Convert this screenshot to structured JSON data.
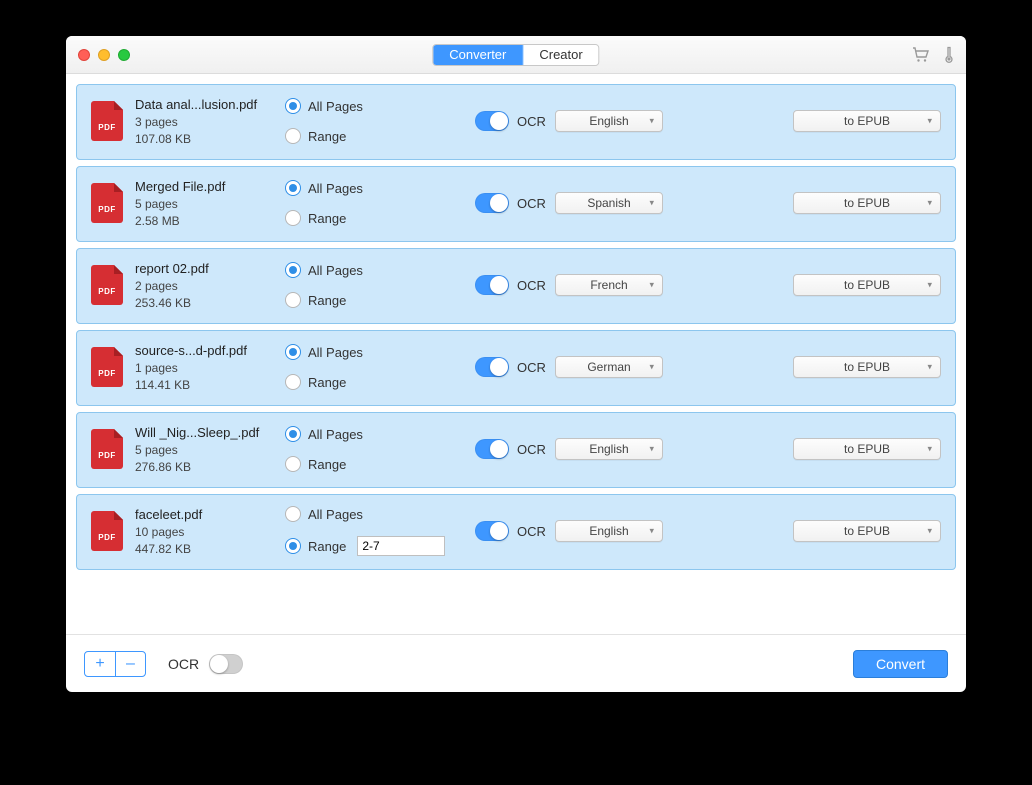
{
  "tabs": {
    "converter": "Converter",
    "creator": "Creator"
  },
  "labels": {
    "all_pages": "All Pages",
    "range": "Range",
    "ocr": "OCR",
    "pdf_badge": "PDF"
  },
  "footer": {
    "ocr_label": "OCR",
    "convert": "Convert",
    "plus": "+",
    "minus": "–"
  },
  "files": [
    {
      "name": "Data anal...lusion.pdf",
      "pages": "3 pages",
      "size": "107.08 KB",
      "page_mode": "all",
      "range_value": "",
      "ocr_on": true,
      "lang": "English",
      "format": "to EPUB"
    },
    {
      "name": "Merged File.pdf",
      "pages": "5 pages",
      "size": "2.58 MB",
      "page_mode": "all",
      "range_value": "",
      "ocr_on": true,
      "lang": "Spanish",
      "format": "to EPUB"
    },
    {
      "name": "report 02.pdf",
      "pages": "2 pages",
      "size": "253.46 KB",
      "page_mode": "all",
      "range_value": "",
      "ocr_on": true,
      "lang": "French",
      "format": "to EPUB"
    },
    {
      "name": "source-s...d-pdf.pdf",
      "pages": "1 pages",
      "size": "114.41 KB",
      "page_mode": "all",
      "range_value": "",
      "ocr_on": true,
      "lang": "German",
      "format": "to EPUB"
    },
    {
      "name": "Will _Nig...Sleep_.pdf",
      "pages": "5 pages",
      "size": "276.86 KB",
      "page_mode": "all",
      "range_value": "",
      "ocr_on": true,
      "lang": "English",
      "format": "to EPUB"
    },
    {
      "name": "faceleet.pdf",
      "pages": "10 pages",
      "size": "447.82 KB",
      "page_mode": "range",
      "range_value": "2-7",
      "ocr_on": true,
      "lang": "English",
      "format": "to EPUB"
    }
  ]
}
